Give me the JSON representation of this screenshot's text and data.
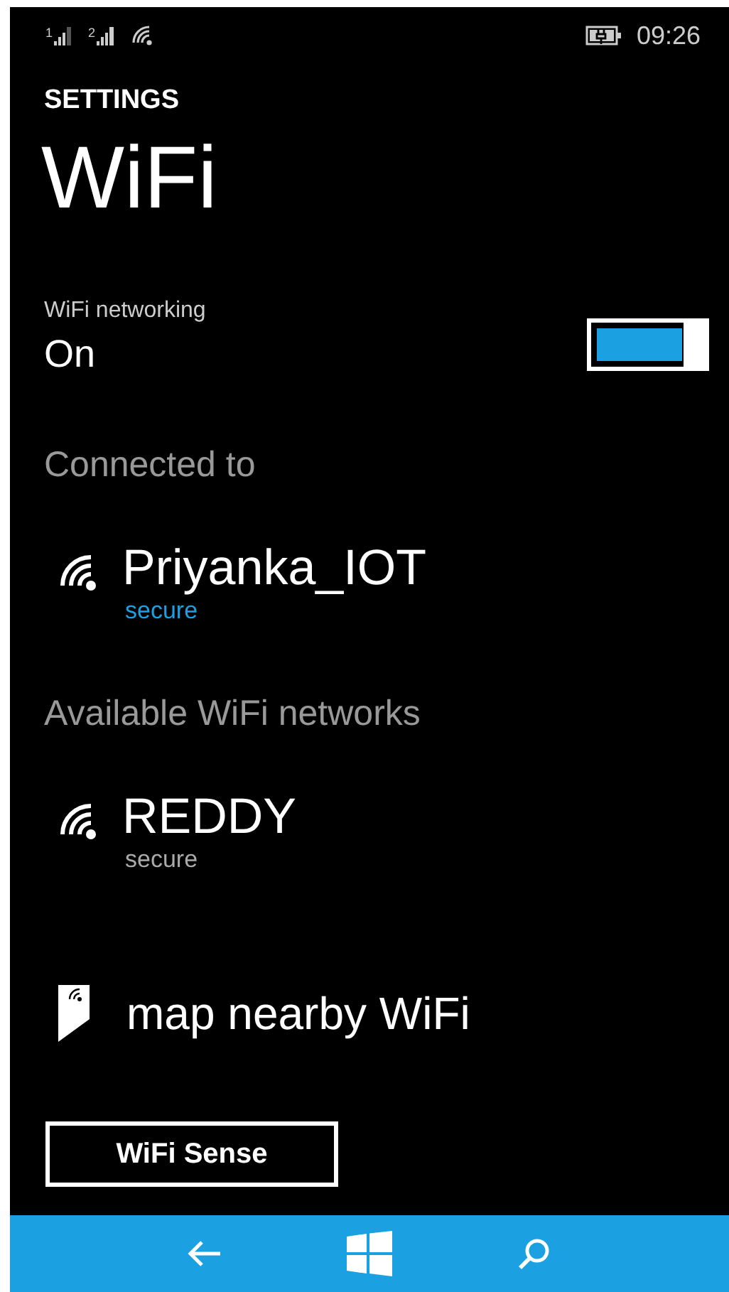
{
  "status_bar": {
    "sims": [
      {
        "label": "1"
      },
      {
        "label": "2"
      }
    ],
    "time": "09:26"
  },
  "header": {
    "section": "SETTINGS",
    "title": "WiFi"
  },
  "wifi_networking": {
    "label": "WiFi networking",
    "value": "On",
    "on": true
  },
  "connected": {
    "heading": "Connected to",
    "networks": [
      {
        "name": "Priyanka_IOT",
        "security": "secure",
        "connected": true
      }
    ]
  },
  "available": {
    "heading": "Available WiFi networks",
    "networks": [
      {
        "name": "REDDY",
        "security": "secure",
        "connected": false
      }
    ]
  },
  "map_link": "map nearby WiFi",
  "button": "WiFi Sense"
}
